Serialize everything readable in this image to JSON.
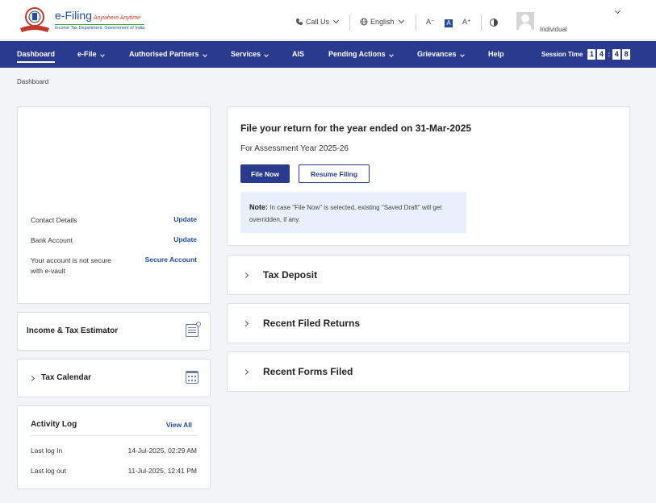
{
  "header": {
    "brand": "e-Filing",
    "tagline": "Anywhere Anytime",
    "subtitle": "Income Tax Department, Government of India",
    "call_us": "Call Us",
    "language": "English",
    "font_decrease": "A⁻",
    "font_default": "A",
    "font_increase": "A⁺",
    "user_role": "Individual"
  },
  "nav": {
    "items": [
      {
        "label": "Dashboard"
      },
      {
        "label": "e-File"
      },
      {
        "label": "Authorised Partners"
      },
      {
        "label": "Services"
      },
      {
        "label": "AIS"
      },
      {
        "label": "Pending Actions"
      },
      {
        "label": "Grievances"
      },
      {
        "label": "Help"
      }
    ],
    "session_label": "Session Time",
    "session_digits": [
      "1",
      "4",
      "4",
      "8"
    ]
  },
  "breadcrumb": "Dashboard",
  "profile": {
    "rows": [
      {
        "label": "Contact Details",
        "link": "Update"
      },
      {
        "label": "Bank Account",
        "link": "Update"
      },
      {
        "label": "Your account is not secure with e-vault",
        "link": "Secure Account"
      }
    ]
  },
  "estimator": {
    "title": "Income & Tax Estimator"
  },
  "calendar": {
    "title": "Tax Calendar"
  },
  "activity": {
    "title": "Activity Log",
    "view_all": "View All",
    "rows": [
      {
        "label": "Last log In",
        "value": "14-Jul-2025, 02:29 AM"
      },
      {
        "label": "Last log out",
        "value": "11-Jul-2025, 12:41 PM"
      }
    ]
  },
  "return_card": {
    "title": "File your return for the year ended on 31-Mar-2025",
    "assessment_year": "For Assessment Year 2025-26",
    "file_now": "File Now",
    "resume": "Resume Filing",
    "note_label": "Note:",
    "note_text": " In case \"File Now\" is selected, existing \"Saved Draft\" will get overridden, if any."
  },
  "accordions": [
    {
      "title": "Tax Deposit"
    },
    {
      "title": "Recent Filed Returns"
    },
    {
      "title": "Recent Forms Filed"
    }
  ],
  "colors": {
    "nav_bg": "#2a3a8f",
    "link": "#1f4e9c",
    "note_bg": "#e8f1fb"
  }
}
